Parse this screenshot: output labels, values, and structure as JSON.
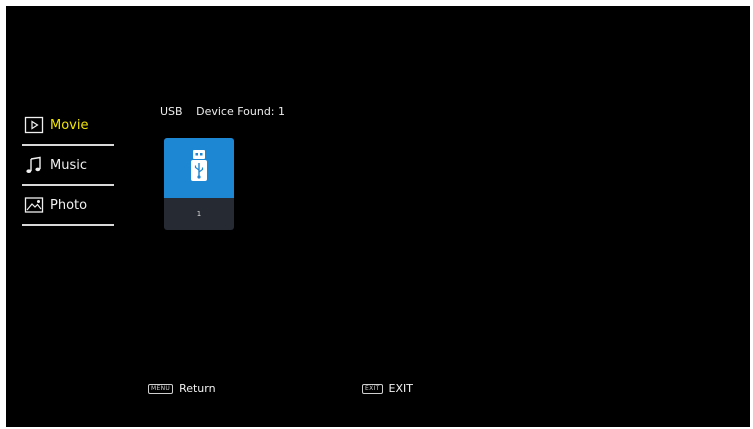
{
  "sidebar": {
    "items": [
      {
        "label": "Movie",
        "icon": "movie-icon",
        "active": true
      },
      {
        "label": "Music",
        "icon": "music-icon",
        "active": false
      },
      {
        "label": "Photo",
        "icon": "photo-icon",
        "active": false
      }
    ]
  },
  "header": {
    "source": "USB",
    "found_label": "Device Found:",
    "found_count": "1"
  },
  "devices": [
    {
      "label": "1",
      "icon": "usb-drive-icon"
    }
  ],
  "footer": {
    "menu_key": "MENU",
    "menu_label": "Return",
    "exit_key": "EXIT",
    "exit_label": "EXIT"
  },
  "colors": {
    "background": "#000000",
    "active_text": "#f2e500",
    "tile_accent": "#1e87d3",
    "tile_base": "#262a33"
  }
}
